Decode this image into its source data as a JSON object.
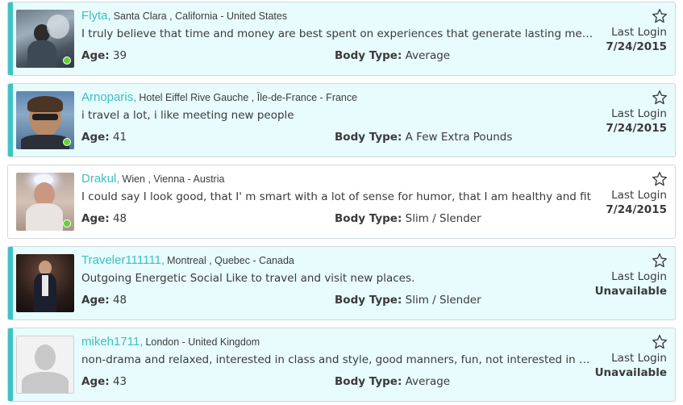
{
  "profiles": [
    {
      "name": "Flyta,",
      "location": "Santa Clara , California - United States",
      "tagline": "I truly believe that time and money are best spent on experiences that generate lasting memories",
      "age_label": "Age:",
      "age": "39",
      "body_type_label": "Body Type:",
      "body_type": "Average",
      "last_login_label": "Last Login",
      "last_login": "7/24/2015",
      "online": true
    },
    {
      "name": "Arnoparis,",
      "location": "Hotel Eiffel Rive Gauche , Île-de-France - France",
      "tagline": "i travel a lot, i like meeting new people",
      "age_label": "Age:",
      "age": "41",
      "body_type_label": "Body Type:",
      "body_type": "A Few Extra Pounds",
      "last_login_label": "Last Login",
      "last_login": "7/24/2015",
      "online": true
    },
    {
      "name": "Drakul,",
      "location": "Wien , Vienna - Austria",
      "tagline": "I could say I look good, that I' m smart with a lot of sense for humor, that I am healthy and fit",
      "age_label": "Age:",
      "age": "48",
      "body_type_label": "Body Type:",
      "body_type": "Slim / Slender",
      "last_login_label": "Last Login",
      "last_login": "7/24/2015",
      "online": true
    },
    {
      "name": "Traveler111111,",
      "location": "Montreal , Quebec - Canada",
      "tagline": "Outgoing Energetic Social Like to travel and visit new places.",
      "age_label": "Age:",
      "age": "48",
      "body_type_label": "Body Type:",
      "body_type": "Slim / Slender",
      "last_login_label": "Last Login",
      "last_login": "Unavailable",
      "online": false
    },
    {
      "name": "mikeh1711,",
      "location": "London - United Kingdom",
      "tagline": "non-drama and relaxed, interested in class and style, good manners, fun, not interested in games",
      "age_label": "Age:",
      "age": "43",
      "body_type_label": "Body Type:",
      "body_type": "Average",
      "last_login_label": "Last Login",
      "last_login": "Unavailable",
      "online": false
    }
  ],
  "colors": {
    "accent": "#3cc3c8",
    "card_tint": "#e8fbfd",
    "online": "#63d237",
    "name": "#3cbfc4"
  },
  "icons": {
    "favorite": "star-outline-icon",
    "online": "online-status-icon"
  }
}
